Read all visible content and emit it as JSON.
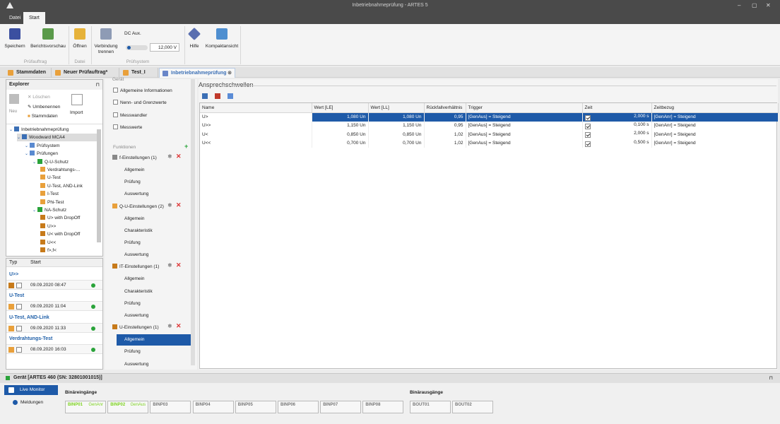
{
  "window": {
    "title": "Inbetriebnahmeprüfung - ARTES 5",
    "controls": [
      "–",
      "▢",
      "✕"
    ]
  },
  "ribbon": {
    "tabs": [
      "Datei",
      "Start"
    ],
    "active_tab": "Start",
    "buttons": {
      "save": "Speichern",
      "report": "Berichtsvorschau",
      "open": "Öffnen",
      "connect": "Verbindung trennen",
      "dc_aux": "DC Aux.",
      "dc_value": "12,000 V",
      "help": "Hilfe",
      "compact": "Kompaktansicht"
    },
    "groups": {
      "pruefauftrag": "Prüfauftrag",
      "datei": "Datei",
      "pruefsystem": "Prüfsystem"
    }
  },
  "doc_tabs": [
    "Stammdaten",
    "Neuer Prüfauftrag*",
    "Test_I",
    "Inbetriebnahmeprüfung"
  ],
  "explorer": {
    "title": "Explorer",
    "pin": "⊓",
    "toolbar": {
      "new": "Neu",
      "delete": "Löschen",
      "rename": "Umbenennen",
      "masterdata": "Stammdaten",
      "import": "Import"
    },
    "tree": [
      {
        "label": "Inbetriebnahmeprüfung",
        "depth": 0
      },
      {
        "label": "Woodward MCA4",
        "depth": 1
      },
      {
        "label": "Prüfsystem",
        "depth": 2
      },
      {
        "label": "Prüfungen",
        "depth": 2
      },
      {
        "label": "Q-U-Schutz",
        "depth": 3
      },
      {
        "label": "Verdrahtungs-...",
        "depth": 4
      },
      {
        "label": "U-Test",
        "depth": 4
      },
      {
        "label": "U-Test, AND-Link",
        "depth": 4
      },
      {
        "label": "I-Test",
        "depth": 4
      },
      {
        "label": "Phi-Test",
        "depth": 4
      },
      {
        "label": "NA-Schutz",
        "depth": 3
      },
      {
        "label": "U> with DropOff",
        "depth": 4
      },
      {
        "label": "U>>",
        "depth": 4
      },
      {
        "label": "U< with DropOff",
        "depth": 4
      },
      {
        "label": "U<<",
        "depth": 4
      },
      {
        "label": "f>,f<",
        "depth": 4
      }
    ]
  },
  "history": {
    "columns": [
      "Typ",
      "Start"
    ],
    "groups": [
      {
        "name": "U>>",
        "start": "09.09.2020 08:47"
      },
      {
        "name": "U-Test",
        "start": "09.09.2020 11:04"
      },
      {
        "name": "U-Test, AND-Link",
        "start": "09.09.2020 11:33"
      },
      {
        "name": "Verdrahtungs-Test",
        "start": "08.09.2020 16:03"
      }
    ]
  },
  "nav": {
    "section_geraet": "Gerät",
    "geraet_items": [
      "Allgemeine Informationen",
      "Nenn- und Grenzwerte",
      "Messwandler",
      "Messwerte"
    ],
    "section_funktionen": "Funktionen",
    "functions": [
      {
        "name": "f-Einstellungen (1)",
        "subs": [
          "Allgemein",
          "Prüfung",
          "Auswertung"
        ]
      },
      {
        "name": "Q-U-Einstellungen (2)",
        "subs": [
          "Allgemein",
          "Charakteristik",
          "Prüfung",
          "Auswertung"
        ]
      },
      {
        "name": "IT-Einstellungen (1)",
        "subs": [
          "Allgemein",
          "Charakteristik",
          "Prüfung",
          "Auswertung"
        ]
      },
      {
        "name": "U-Einstellungen (1)",
        "subs": [
          "Allgemein",
          "Prüfung",
          "Auswertung"
        ]
      }
    ],
    "selected": "U-Einstellungen (1) / Allgemein"
  },
  "main": {
    "title": "Ansprechschwellen",
    "columns": [
      "Name",
      "Wert [LE]",
      "Wert [LL]",
      "Rückfallverhältnis",
      "Trigger",
      "Zeit",
      "Zeitbezug"
    ],
    "rows": [
      {
        "name": "U>",
        "le": "1,080 Un",
        "ll": "1,080 Un",
        "ratio": "0,95",
        "trigger": "[GenAus] = Steigend",
        "zeit": "2,000 s",
        "bezug": "[GenAnr] = Steigend"
      },
      {
        "name": "U>>",
        "le": "1,150 Un",
        "ll": "1,150 Un",
        "ratio": "0,95",
        "trigger": "[GenAus] = Steigend",
        "zeit": "0,100 s",
        "bezug": "[GenAnr] = Steigend"
      },
      {
        "name": "U<",
        "le": "0,850 Un",
        "ll": "0,850 Un",
        "ratio": "1,02",
        "trigger": "[GenAus] = Steigend",
        "zeit": "2,000 s",
        "bezug": "[GenAnr] = Steigend"
      },
      {
        "name": "U<<",
        "le": "0,700 Un",
        "ll": "0,700 Un",
        "ratio": "1,02",
        "trigger": "[GenAus] = Steigend",
        "zeit": "0,500 s",
        "bezug": "[GenAnr] = Steigend"
      }
    ]
  },
  "device": {
    "label": "Gerät [ARTES 460 (SN: 32801001015)]",
    "live_monitor": "Live Monitor",
    "messages": "Meldungen",
    "binary_inputs_title": "Binäreingänge",
    "binary_outputs_title": "Binärausgänge",
    "binary_inputs": [
      {
        "name": "BINP01",
        "sub": "GenAnr",
        "active": true
      },
      {
        "name": "BINP02",
        "sub": "GenAus",
        "active": true
      },
      {
        "name": "BINP03",
        "sub": "",
        "active": false
      },
      {
        "name": "BINP04",
        "sub": "",
        "active": false
      },
      {
        "name": "BINP05",
        "sub": "",
        "active": false
      },
      {
        "name": "BINP06",
        "sub": "",
        "active": false
      },
      {
        "name": "BINP07",
        "sub": "",
        "active": false
      },
      {
        "name": "BINP08",
        "sub": "",
        "active": false
      }
    ],
    "binary_outputs": [
      {
        "name": "BOUT01"
      },
      {
        "name": "BOUT02"
      }
    ]
  },
  "colors": {
    "accent": "#1e5aa8",
    "active_led": "#7ed321",
    "ok_dot": "#2aa33a",
    "delete_x": "#d33333"
  }
}
